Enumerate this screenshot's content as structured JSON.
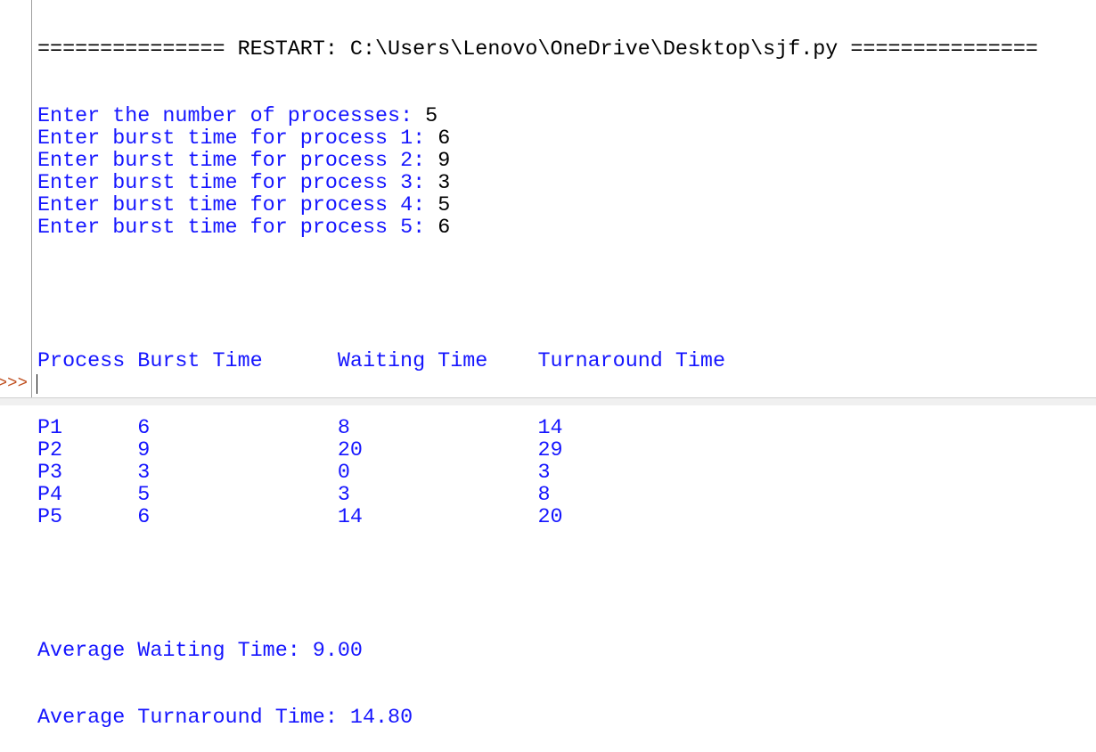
{
  "restart_line": "=============== RESTART: C:\\Users\\Lenovo\\OneDrive\\Desktop\\sjf.py ===============",
  "inputs": [
    {
      "prompt": "Enter the number of processes: ",
      "value": "5"
    },
    {
      "prompt": "Enter burst time for process 1: ",
      "value": "6"
    },
    {
      "prompt": "Enter burst time for process 2: ",
      "value": "9"
    },
    {
      "prompt": "Enter burst time for process 3: ",
      "value": "3"
    },
    {
      "prompt": "Enter burst time for process 4: ",
      "value": "5"
    },
    {
      "prompt": "Enter burst time for process 5: ",
      "value": "6"
    }
  ],
  "table": {
    "headers": [
      "Process",
      "Burst Time",
      "Waiting Time",
      "Turnaround Time"
    ],
    "rows": [
      [
        "P1",
        "6",
        "8",
        "14"
      ],
      [
        "P2",
        "9",
        "20",
        "29"
      ],
      [
        "P3",
        "3",
        "0",
        "3"
      ],
      [
        "P4",
        "5",
        "3",
        "8"
      ],
      [
        "P5",
        "6",
        "14",
        "20"
      ]
    ]
  },
  "avg_waiting": "Average Waiting Time: 9.00",
  "avg_turnaround": "Average Turnaround Time: 14.80",
  "shell_prompt": ">>>"
}
